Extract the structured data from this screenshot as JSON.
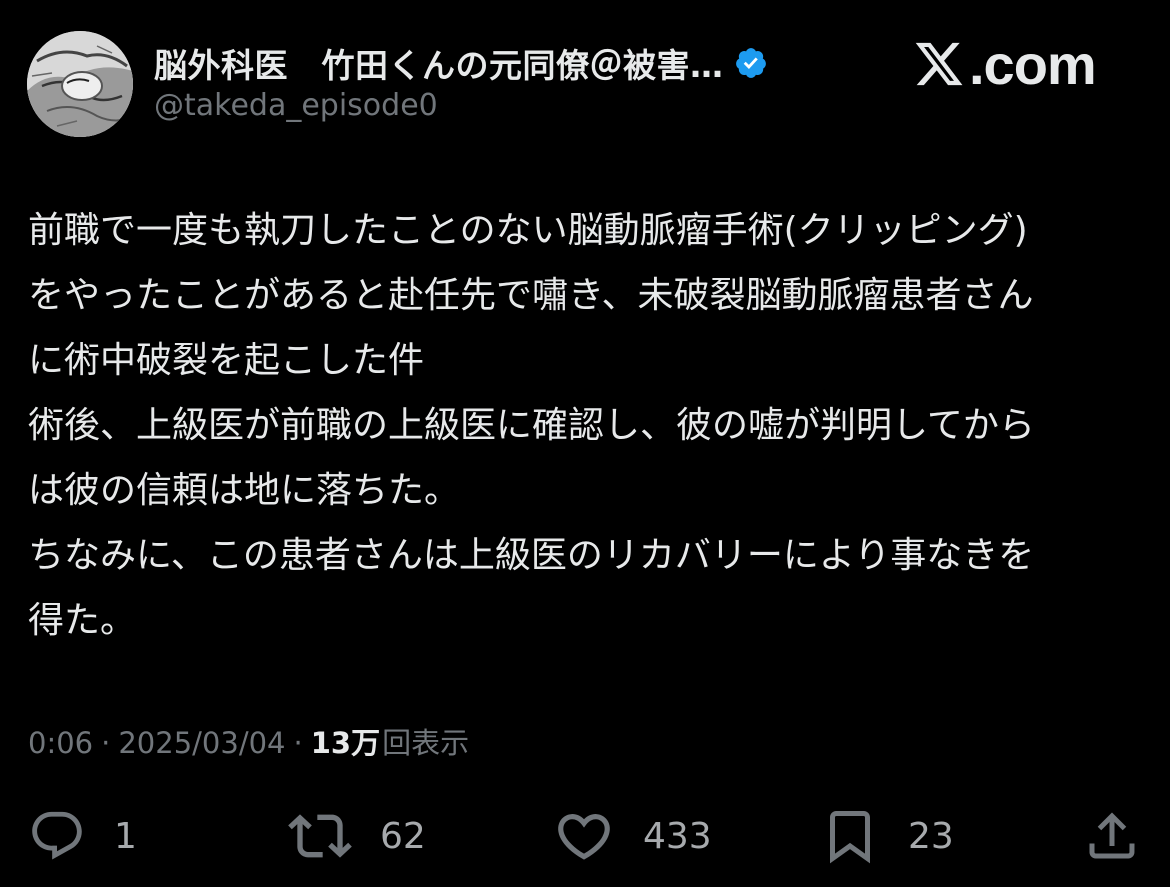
{
  "author": {
    "display_name": "脳外科医　竹田くんの元同僚＠被害…",
    "handle": "@takeda_episode0",
    "verified_icon": "verified-badge-icon"
  },
  "brand": {
    "text": ".com",
    "logo_icon": "x-logo-icon"
  },
  "post": {
    "lines": [
      "前職で一度も執刀したことのない脳動脈瘤手術(クリッピング)",
      "をやったことがあると赴任先で嘯き、未破裂脳動脈瘤患者さん",
      "に術中破裂を起こした件",
      "術後、上級医が前職の上級医に確認し、彼の嘘が判明してから",
      "は彼の信頼は地に落ちた。",
      "ちなみに、この患者さんは上級医のリカバリーにより事なきを",
      "得た。"
    ]
  },
  "meta": {
    "time": "0:06",
    "separator": "·",
    "date": "2025/03/04",
    "views_count": "13万",
    "views_label": "回表示"
  },
  "actions": {
    "reply_count": "1",
    "repost_count": "62",
    "like_count": "433",
    "bookmark_count": "23"
  },
  "colors": {
    "background": "#000000",
    "text_primary": "#e7e9ea",
    "text_secondary": "#71767b",
    "verified_blue": "#1d9bf0"
  }
}
